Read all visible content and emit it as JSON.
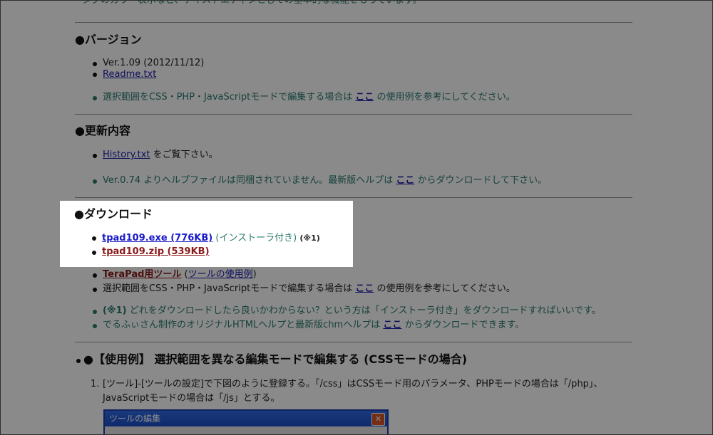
{
  "intro": {
    "text": "タグのカラー表示など、テキストエディタとしての基本的な機能をもっています。"
  },
  "version": {
    "heading": "●バージョン",
    "ver": "Ver.1.09 (2012/11/12)",
    "readme": "Readme.txt",
    "note_before": "選択範囲をCSS・PHP・JavaScriptモードで編集する場合は",
    "note_link": "ここ",
    "note_after": "の使用例を参考にしてください。"
  },
  "changes": {
    "heading": "●更新内容",
    "history_link": "History.txt",
    "history_after": "をご覧下さい。",
    "help_before": "Ver.0.74 よりヘルプファイルは同梱されていません。最新版ヘルプは",
    "help_link": "ここ",
    "help_after": "からダウンロードして下さい。"
  },
  "download": {
    "heading": "●ダウンロード",
    "exe_link": "tpad109.exe (776KB)",
    "exe_note": "(インストーラ付き)",
    "exe_mark": "(※1)",
    "zip_link": "tpad109.zip (539KB)",
    "tool_link": "TeraPad用ツール",
    "tool_paren_open": "(",
    "tool_usage_link": "ツールの使用例",
    "tool_paren_close": ")",
    "note_before": "選択範囲をCSS・PHP・JavaScriptモードで編集する場合は",
    "note_link": "ここ",
    "note_after": "の使用例を参考にしてください。",
    "q_mark": "(※1)",
    "q_text": "どれをダウンロードしたら良いかわからない？という方は「インストーラ付き」をダウンロードすればいいです。",
    "help_before": "でるふぃさん制作のオリジナルHTMLヘルプと最新版chmヘルプは",
    "help_link": "ここ",
    "help_after": "からダウンロードできます。"
  },
  "example": {
    "heading": "●【使用例】 選択範囲を異なる編集モードで編集する (CSSモードの場合)",
    "step_num": "1.",
    "step_line1": "[ツール]-[ツールの設定]で下図のように登録する。「/css」はCSSモード用のパラメータ、PHPモードの場合は「/php」、",
    "step_line2": "JavaScriptモードの場合は「/js」とする。",
    "dialog_title": "ツールの編集",
    "dialog_close": "✕"
  }
}
